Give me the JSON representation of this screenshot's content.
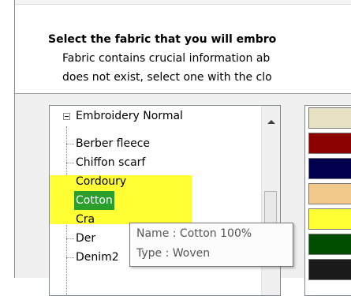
{
  "header": {
    "title": "Select the fabric that you will embro",
    "desc_line1": "Fabric contains crucial information ab",
    "desc_line2": "does not exist, select one with the clo"
  },
  "tree": {
    "root_label": "Embroidery Normal",
    "items": [
      {
        "label": "Berber fleece"
      },
      {
        "label": "Chiffon scarf"
      },
      {
        "label": "Cordoury"
      },
      {
        "label": "Cotton"
      },
      {
        "label": "Cra"
      },
      {
        "label": "Der"
      },
      {
        "label": "Denim2"
      }
    ],
    "selected": "Cotton",
    "highlight_color": "#ffff33",
    "selected_color": "#2b9f2b"
  },
  "swatches": [
    "#e8e2c4",
    "#8b0000",
    "#00004d",
    "#f2c98a",
    "#ffff33",
    "#004d00",
    "#1a1a1a"
  ],
  "tooltip": {
    "name_line": "Name : Cotton 100%",
    "type_line": "Type : Woven"
  }
}
